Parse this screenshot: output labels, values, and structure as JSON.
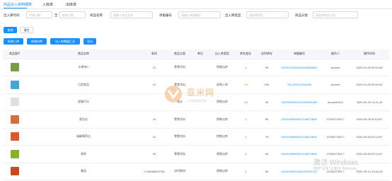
{
  "tabs": [
    {
      "label": "商品出入库明细表"
    },
    {
      "label": "入库单"
    },
    {
      "label": "出库单"
    }
  ],
  "filters": {
    "time_label": "出入库时间",
    "start_placeholder": "开始日期",
    "range_sep": "至",
    "end_placeholder": "结束日期",
    "product_name_label": "商品名称",
    "product_name_placeholder": "请输入商品名称",
    "doc_no_label": "单据编号",
    "doc_no_placeholder": "请输入单据编号",
    "type_label": "出入库类型",
    "type_placeholder": "请选择类型",
    "category_label": "商品分类",
    "category_placeholder": "请选择商品分类"
  },
  "actions": {
    "search": "查询",
    "reset": "清空",
    "new_in": "新增入库",
    "new_out": "新增出库",
    "in_out_summary": "出入库数据汇总",
    "export": "导出"
  },
  "table": {
    "columns": [
      "商品图片",
      "商品名称",
      "条码",
      "商品分类",
      "单位",
      "出入库类型",
      "库存变化",
      "实时库存",
      "单据编号",
      "操作人",
      "操作时间"
    ],
    "rows": [
      {
        "image": "product-thumb",
        "color": "#7a9a4a",
        "name": "水果茶C",
        "barcode": "21",
        "category": "零食饮料",
        "unit": "",
        "type": "销售出库",
        "change": "-1",
        "stock": "99",
        "doc": "00202010260054425885982",
        "operator": "dounee",
        "time": "2020-10-28 09:44:48"
      },
      {
        "image": "product-thumb",
        "color": "#4aa3d8",
        "name": "日用商品",
        "barcode": "21",
        "category": "零食饮料",
        "unit": "",
        "type": "采购入库",
        "change": "+10",
        "stock": "100",
        "doc": "RK-202010264438",
        "operator": "dounee",
        "time": "2020-10-28 09:44:44"
      },
      {
        "image": "product-thumb",
        "color": "#e0e0e0",
        "name": "面霜可乐",
        "barcode": "",
        "category": "清水",
        "unit": "",
        "type": "销售出库",
        "change": "-10",
        "stock": "40",
        "doc": "00202008301121559281482",
        "operator": "dounee0011",
        "time": "2020-09-29 11:21:43"
      },
      {
        "image": "product-thumb",
        "color": "#d07040",
        "name": "面包论",
        "barcode": "24",
        "category": "零食饮料",
        "unit": "",
        "type": "销售出库",
        "change": "-1",
        "stock": "95",
        "doc": "00202008050512248278831",
        "operator": "1376427303\n7",
        "time": "2020-05-28 00:14:57"
      },
      {
        "image": "product-thumb",
        "color": "#d85a2a",
        "name": "瑞峰薄荷达",
        "barcode": "22",
        "category": "零食饮料",
        "unit": "",
        "type": "销售出库",
        "change": "-1",
        "stock": "75",
        "doc": "00202008050512248278831",
        "operator": "1376427303\n7",
        "time": "2020-05-28 00:14:57"
      },
      {
        "image": "product-thumb",
        "color": "#8ab030",
        "name": "清茶",
        "barcode": "25",
        "category": "零食饮料",
        "unit": "",
        "type": "销售出库",
        "change": "-1",
        "stock": "94",
        "doc": "00202008050512248278831",
        "operator": "1376427303\n7",
        "time": "2020-05-28 00:14:57"
      },
      {
        "image": "product-thumb",
        "color": "#c84a20",
        "name": "番茄",
        "barcode": "1748058600708",
        "category": "应时鲜材",
        "unit": "",
        "type": "销售出库",
        "change": "-1",
        "stock": "69",
        "doc": "00202008010064425937147",
        "operator": "1376427303\n7",
        "time": "2020-05-10 10:44:28"
      }
    ]
  },
  "watermark": {
    "brand": "亚米网",
    "sub": "让传统更易经营"
  },
  "windows": {
    "line1": "激活 Windows",
    "line2": "转到\"设置\"以激活 Windows。"
  }
}
